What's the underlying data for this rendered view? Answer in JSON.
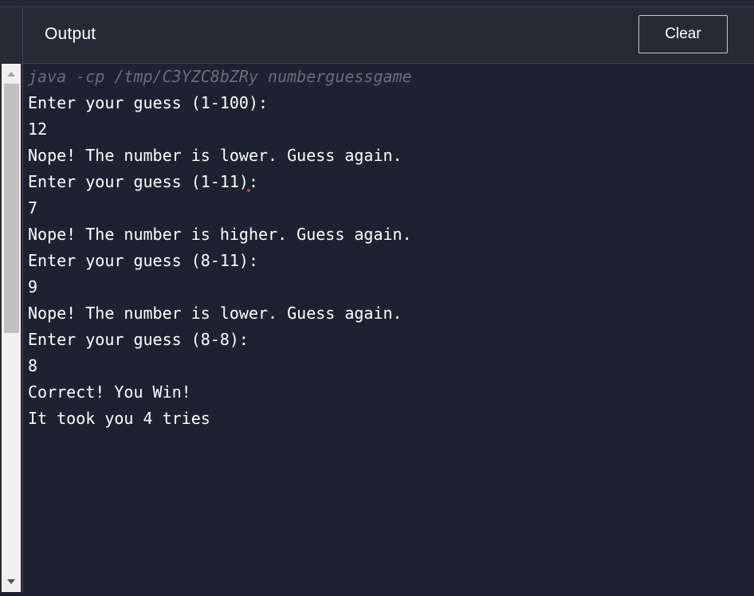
{
  "header": {
    "title": "Output",
    "clear_label": "Clear"
  },
  "output": {
    "command": "java -cp /tmp/C3YZC8bZRy numberguessgame",
    "lines": [
      "Enter your guess (1-100):",
      "12",
      "Nope! The number is lower. Guess again.",
      "Enter your guess (1-11):",
      "7",
      "Nope! The number is higher. Guess again.",
      "Enter your guess (8-11):",
      "9",
      "Nope! The number is lower. Guess again.",
      "Enter your guess (8-8):",
      "8",
      "Correct! You Win!",
      "It took you 4 tries"
    ]
  },
  "colors": {
    "background": "#1d2230",
    "header_bg": "#262a34",
    "text": "#ffffff",
    "command_text": "#6a6f7c",
    "button_border": "#c8c8c8"
  },
  "icons": {
    "scroll_up": "triangle-up-icon",
    "scroll_down": "triangle-down-icon"
  }
}
